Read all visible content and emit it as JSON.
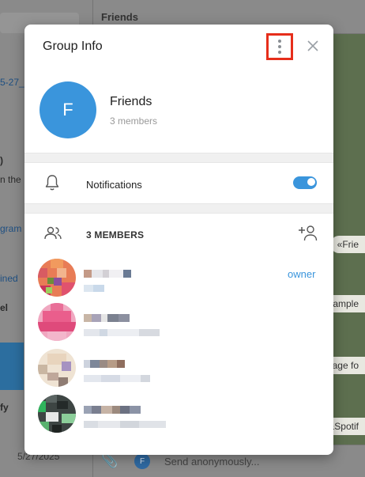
{
  "background": {
    "chat_title": "Friends",
    "composer_placeholder": "Send anonymously...",
    "composer_avatar_initial": "F",
    "left_snippets": [
      "5-27_",
      ")",
      "n the",
      "gram",
      "ined",
      "el",
      "fy",
      "5/27/2025"
    ],
    "right_pills": [
      "«Frie",
      "Sample",
      "sage fo",
      "&Spotif"
    ]
  },
  "modal": {
    "title": "Group Info",
    "menu_icon": "more-vertical-icon",
    "close_icon": "close-icon",
    "group": {
      "avatar_initial": "F",
      "avatar_color": "#3a95dc",
      "name": "Friends",
      "members_count_label": "3 members"
    },
    "notifications": {
      "label": "Notifications",
      "enabled": true,
      "icon": "bell-icon"
    },
    "members_section": {
      "header": "3 MEMBERS",
      "icon": "members-icon",
      "add_icon": "add-member-icon"
    },
    "members": [
      {
        "role": "owner"
      },
      {
        "role": ""
      },
      {
        "role": ""
      },
      {
        "role": ""
      }
    ]
  },
  "colors": {
    "accent": "#3a95dc",
    "highlight_box": "#e62e1b"
  }
}
